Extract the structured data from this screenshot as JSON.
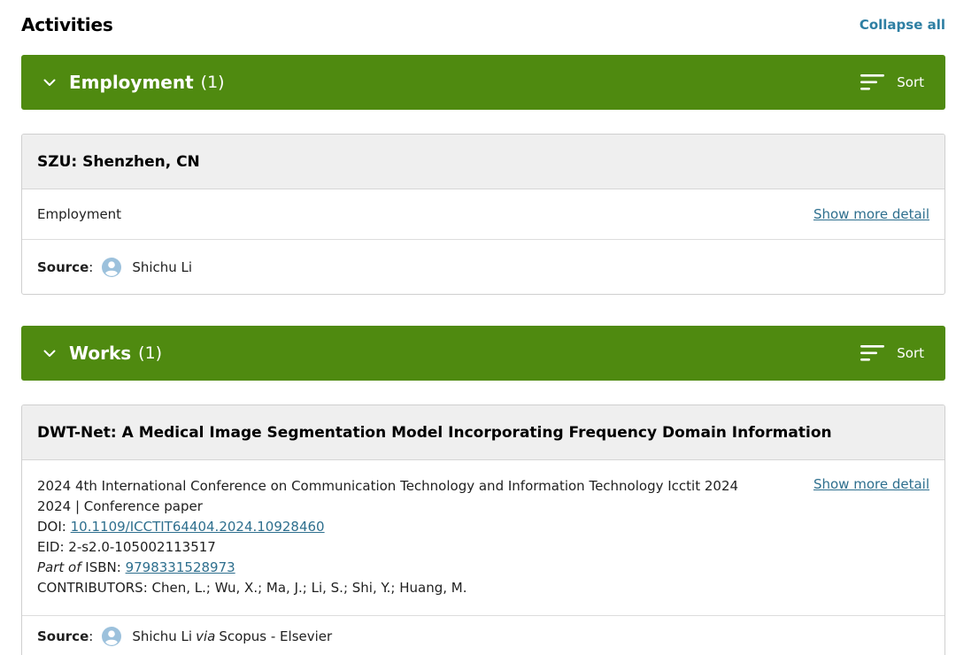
{
  "header": {
    "title": "Activities",
    "collapse_all": "Collapse all"
  },
  "employment_section": {
    "name": "Employment",
    "count": "(1)",
    "sort_label": "Sort"
  },
  "employment_card": {
    "title": "SZU: Shenzhen, CN",
    "type": "Employment",
    "show_more": "Show more detail",
    "source_label": "Source",
    "source_name": "Shichu Li"
  },
  "works_section": {
    "name": "Works",
    "count": "(1)",
    "sort_label": "Sort"
  },
  "work_card": {
    "title": "DWT-Net: A Medical Image Segmentation Model Incorporating Frequency Domain Information",
    "venue": "2024 4th International Conference on Communication Technology and Information Technology Icctit 2024",
    "meta": "2024 | Conference paper",
    "doi_label": "DOI:",
    "doi": "10.1109/ICCTIT64404.2024.10928460",
    "eid": "EID: 2-s2.0-105002113517",
    "part_of": "Part of",
    "isbn_label": "ISBN:",
    "isbn": "9798331528973",
    "contributors": "CONTRIBUTORS: Chen, L.; Wu, X.; Ma, J.; Li, S.; Shi, Y.; Huang, M.",
    "show_more": "Show more detail",
    "source_label": "Source",
    "source_name": "Shichu Li",
    "via": "via",
    "source_via": "Scopus - Elsevier"
  },
  "colors": {
    "section_green": "#4f8a10",
    "link_blue": "#2e6f8e",
    "avatar_blue": "#9cc1dc"
  },
  "icons": {
    "chevron": "chevron-down-icon",
    "sort": "sort-lines-icon",
    "avatar": "user-avatar-icon"
  }
}
